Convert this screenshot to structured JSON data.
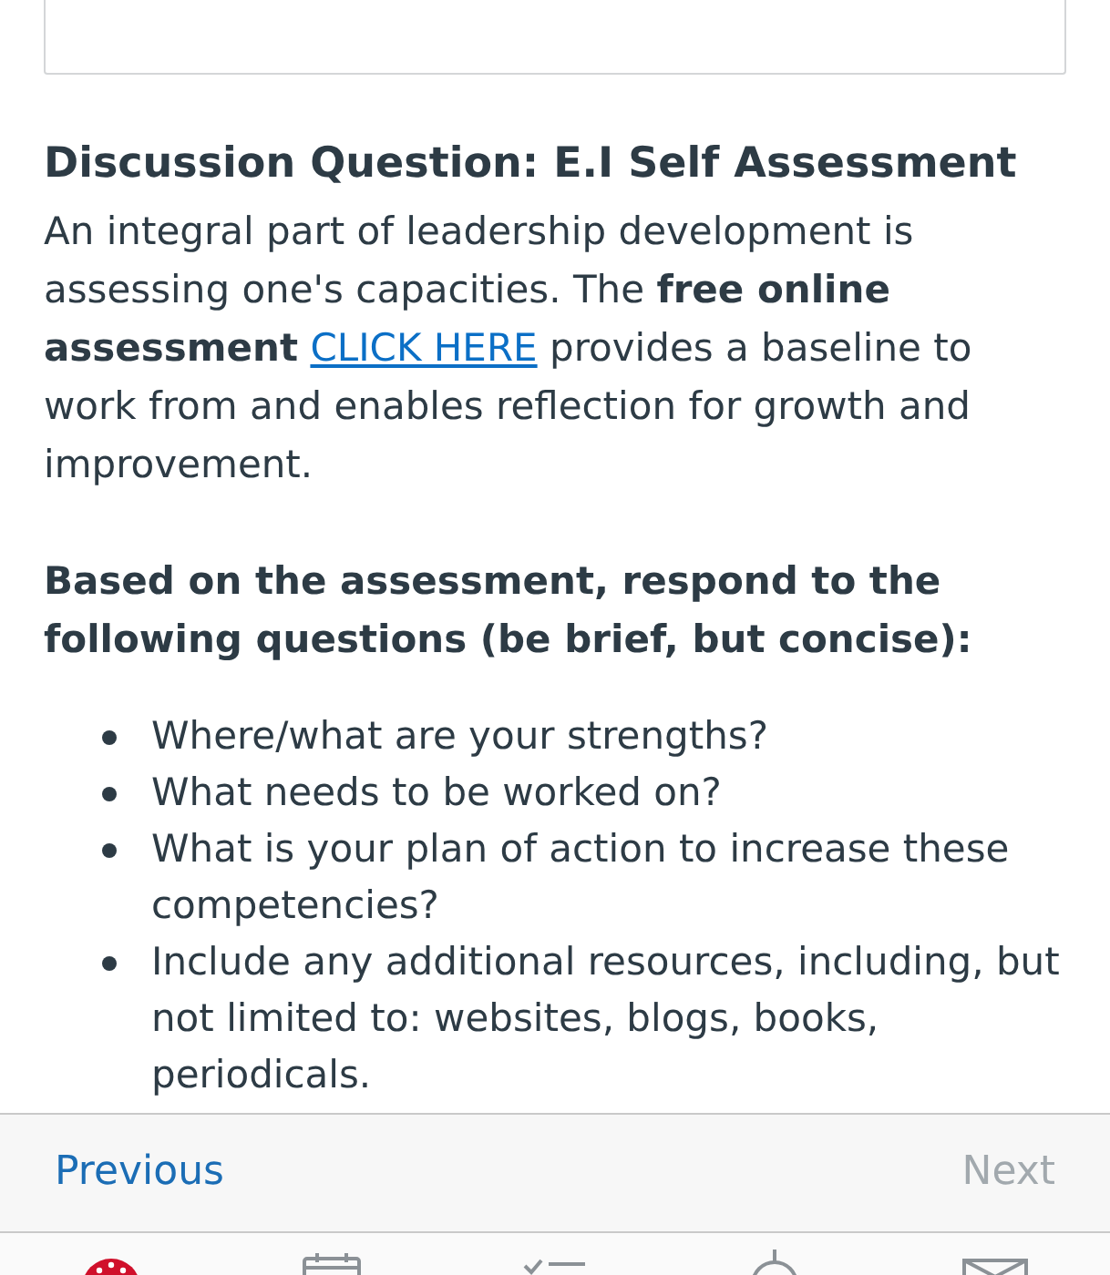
{
  "discussion": {
    "title": "Discussion Question: E.I Self Assessment",
    "intro": {
      "before": "An integral part of leadership development is assessing one's capacities. The **free online assessment**",
      "link": "CLICK HERE",
      "after": "provides a baseline to work from and enables reflection for growth and improvement."
    },
    "instructions": "Based on the assessment, respond to the following questions (be brief, but concise):",
    "questions": [
      "Where/what are your strengths?",
      "What needs to be worked on?",
      "What is your plan of action to increase these competencies?",
      "Include any additional resources, including, but not limited to: websites, blogs, books, periodicals."
    ]
  },
  "footer_nav": {
    "previous": {
      "label": "Previous",
      "disabled": false
    },
    "next": {
      "label": "Next",
      "disabled": true
    }
  },
  "tab_bar": {
    "items": [
      {
        "kind": "dashboard",
        "selected": true
      },
      {
        "kind": "calendar",
        "selected": false
      },
      {
        "kind": "todo",
        "selected": false
      },
      {
        "kind": "notifications",
        "selected": false
      },
      {
        "kind": "inbox",
        "selected": false
      }
    ]
  }
}
